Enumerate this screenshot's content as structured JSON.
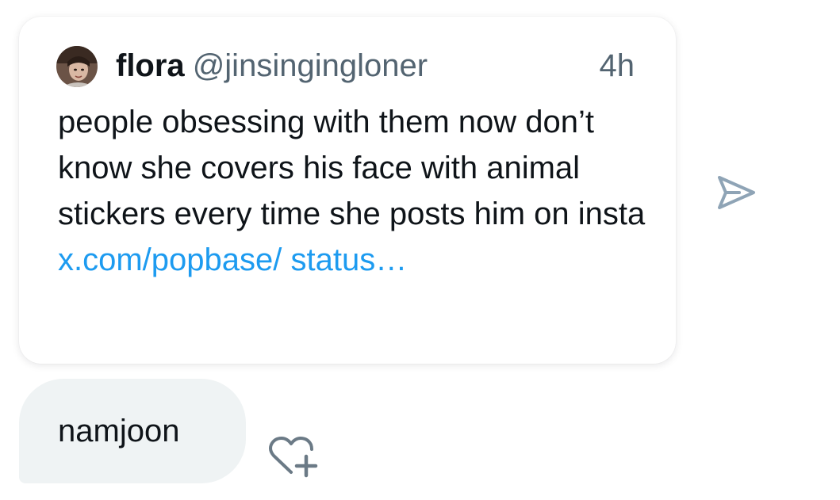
{
  "shared_post": {
    "author_name": "flora",
    "author_handle": "@jinsingingloner",
    "timestamp": "4h",
    "text": "people obsessing with them now don’t know she covers his face with animal stickers every time she posts him on insta ",
    "link_text": "x.com/popbase/ status…",
    "avatar_icon": "profile-photo"
  },
  "message": {
    "text": "namjoon"
  },
  "icons": {
    "send": "send-arrow-icon",
    "react": "heart-plus-icon"
  },
  "colors": {
    "link": "#1d9bf0",
    "secondary_text": "#536471",
    "primary_text": "#0f1419",
    "bubble_bg": "#eff3f4",
    "icon_gray": "#8fa4b6"
  }
}
